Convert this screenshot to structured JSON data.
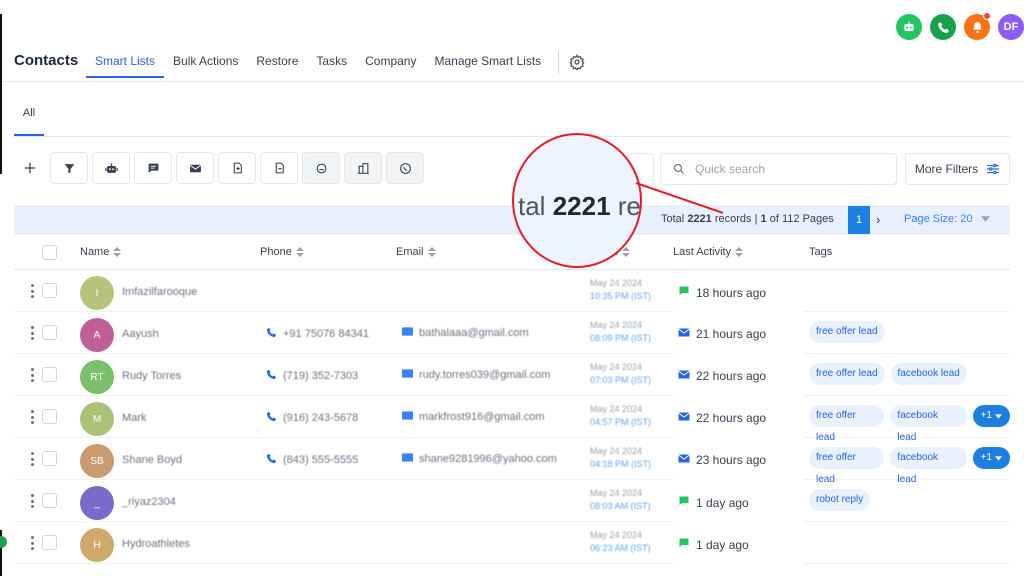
{
  "header": {
    "title": "Contacts",
    "nav": [
      "Smart Lists",
      "Bulk Actions",
      "Restore",
      "Tasks",
      "Company",
      "Manage Smart Lists"
    ],
    "active_nav": "Smart Lists",
    "user_initials": "DF"
  },
  "subtabs": {
    "all": "All"
  },
  "search": {
    "placeholder": "Quick search"
  },
  "filters": {
    "more_label": "More Filters"
  },
  "pagination": {
    "total_label": "Total",
    "total": "2221",
    "records_label": "records",
    "sep": "|",
    "current": "1",
    "of_label": "of",
    "pages": "112",
    "pages_label": "Pages",
    "page_size_label": "Page Size: 20"
  },
  "zoom": {
    "prefix": "tal ",
    "number": "2221",
    "suffix": " rec"
  },
  "table": {
    "columns": [
      "Name",
      "Phone",
      "Email",
      "ed",
      "Last Activity",
      "Tags"
    ],
    "rows": [
      {
        "initial": "I",
        "name": "Imfazilfarooque",
        "phone": "",
        "email": "",
        "date": "May 24 2024",
        "time": "10:35 PM (IST)",
        "activity": "18 hours ago",
        "activity_type": "chat",
        "color": "#b5c47a",
        "tags": [],
        "more": ""
      },
      {
        "initial": "A",
        "name": "Aayush",
        "phone": "+91 75076 84341",
        "email": "bathalaaa@gmail.com",
        "date": "May 24 2024",
        "time": "08:09 PM (IST)",
        "activity": "21 hours ago",
        "activity_type": "email",
        "color": "#c0609a",
        "tags": [
          "free offer lead"
        ],
        "more": ""
      },
      {
        "initial": "RT",
        "name": "Rudy Torres",
        "phone": "(719) 352-7303",
        "email": "rudy.torres039@gmail.com",
        "date": "May 24 2024",
        "time": "07:03 PM (IST)",
        "activity": "22 hours ago",
        "activity_type": "email",
        "color": "#7bbf6a",
        "tags": [
          "free offer lead",
          "facebook lead"
        ],
        "more": ""
      },
      {
        "initial": "M",
        "name": "Mark",
        "phone": "(916) 243-5678",
        "email": "markfrost916@gmail.com",
        "date": "May 24 2024",
        "time": "04:57 PM (IST)",
        "activity": "22 hours ago",
        "activity_type": "email",
        "color": "#a9c275",
        "tags": [
          "free offer lead",
          "facebook lead"
        ],
        "more": "+1"
      },
      {
        "initial": "SB",
        "name": "Shane Boyd",
        "phone": "(843) 555-5555",
        "email": "shane9281996@yahoo.com",
        "date": "May 24 2024",
        "time": "04:18 PM (IST)",
        "activity": "23 hours ago",
        "activity_type": "email",
        "color": "#c99a6e",
        "tags": [
          "free offer lead",
          "facebook lead"
        ],
        "more": "+1"
      },
      {
        "initial": "_",
        "name": "_riyaz2304",
        "phone": "",
        "email": "",
        "date": "May 24 2024",
        "time": "08:03 AM (IST)",
        "activity": "1 day ago",
        "activity_type": "chat",
        "color": "#7c6ac9",
        "tags": [
          "robot reply"
        ],
        "more": ""
      },
      {
        "initial": "H",
        "name": "Hydroathletes",
        "phone": "",
        "email": "",
        "date": "May 24 2024",
        "time": "06:23 AM (IST)",
        "activity": "1 day ago",
        "activity_type": "chat",
        "color": "#cfa86b",
        "tags": [],
        "more": ""
      }
    ]
  },
  "colors": {
    "accent": "#2563eb",
    "annotation": "#e11d2a",
    "chat_icon": "#22c55e",
    "email_icon": "#2563eb"
  }
}
